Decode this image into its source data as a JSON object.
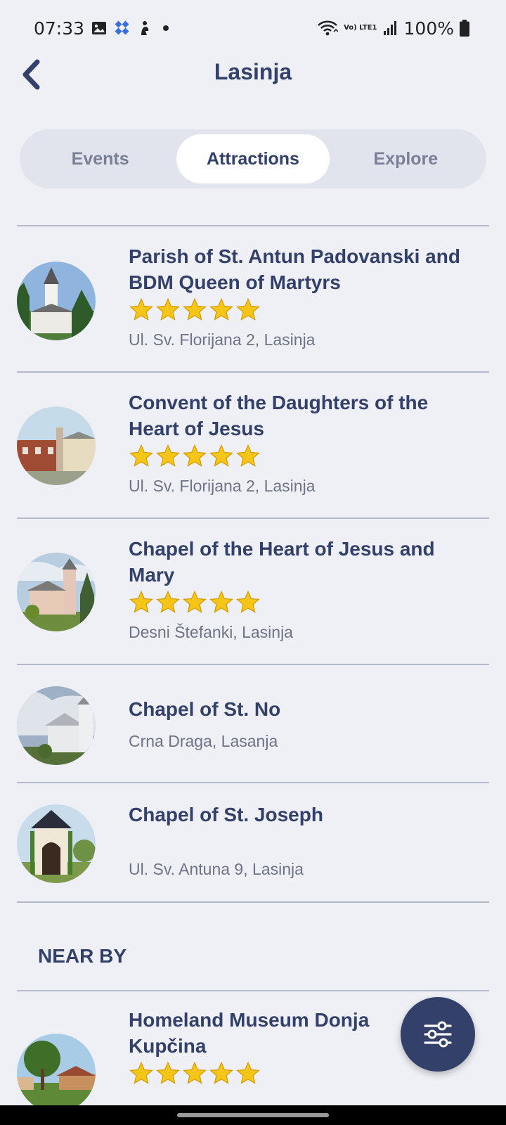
{
  "status_bar": {
    "time": "07:33",
    "battery": "100%",
    "network_label": "Vo) LTE1"
  },
  "header": {
    "title": "Lasinja"
  },
  "tabs": [
    {
      "label": "Events",
      "active": false
    },
    {
      "label": "Attractions",
      "active": true
    },
    {
      "label": "Explore",
      "active": false
    }
  ],
  "attractions": [
    {
      "title": "Parish of St. Antun Padovanski and BDM Queen of Martyrs",
      "stars": 5,
      "address": "Ul. Sv. Florijana 2, Lasinja"
    },
    {
      "title": "Convent of the Daughters of the Heart of Jesus",
      "stars": 5,
      "address": "Ul. Sv. Florijana 2, Lasinja"
    },
    {
      "title": "Chapel of the Heart of Jesus and Mary",
      "stars": 5,
      "address": "Desni Štefanki, Lasinja"
    },
    {
      "title": "Chapel of St. No",
      "stars": 0,
      "address": "Crna Draga, Lasanja"
    },
    {
      "title": "Chapel of St. Joseph",
      "stars": 0,
      "address": "Ul. Sv. Antuna 9, Lasinja"
    }
  ],
  "nearby": {
    "heading": "NEAR BY",
    "items": [
      {
        "title": "Homeland Museum Donja Kupčina",
        "stars": 5
      }
    ]
  },
  "colors": {
    "background": "#eff0f6",
    "primary": "#33406a",
    "muted_text": "#6e7386",
    "star": "#f5c518",
    "divider": "#b4b9c9"
  },
  "icons": {
    "back": "chevron-left-icon",
    "filter": "sliders-icon",
    "star": "star-icon"
  }
}
